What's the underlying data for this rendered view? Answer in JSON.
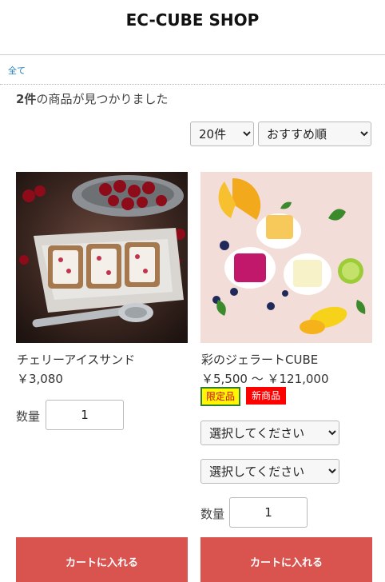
{
  "header": {
    "shop_title": "EC-CUBE SHOP"
  },
  "breadcrumb": {
    "all_label": "全て"
  },
  "results": {
    "count": "2件",
    "suffix": "の商品が見つかりました"
  },
  "controls": {
    "per_page": {
      "selected": "20件"
    },
    "sort": {
      "selected": "おすすめ順"
    }
  },
  "products": [
    {
      "name": "チェリーアイスサンド",
      "price": "￥3,080",
      "quantity_label": "数量",
      "quantity": "1",
      "cart_label": "カートに入れる",
      "image_icon": "cherry-ice-sandwich-photo"
    },
    {
      "name": "彩のジェラートCUBE",
      "price": "￥5,500 ～ ￥121,000",
      "tags": [
        "限定品",
        "新商品"
      ],
      "option1": "選択してください",
      "option2": "選択してください",
      "quantity_label": "数量",
      "quantity": "1",
      "cart_label": "カートに入れる",
      "image_icon": "gelato-cube-photo"
    }
  ],
  "colors": {
    "cart_button": "#d9534f",
    "link": "#1b7fc2",
    "tag_new_bg": "#ff0000",
    "tag_limited_bg": "#fff600"
  }
}
